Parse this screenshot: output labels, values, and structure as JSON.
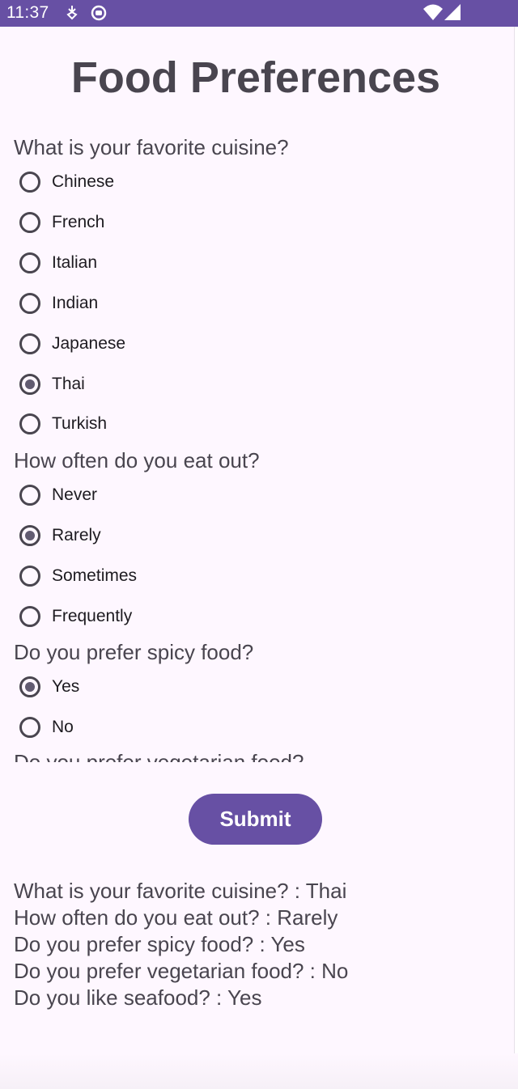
{
  "status_bar": {
    "time": "11:37",
    "icons": [
      "download-icon",
      "app-icon",
      "wifi-icon",
      "signal-icon"
    ],
    "color": "#6750a4"
  },
  "title": "Food Preferences",
  "questions": [
    {
      "label": "What is your favorite cuisine?",
      "options": [
        "Chinese",
        "French",
        "Italian",
        "Indian",
        "Japanese",
        "Thai",
        "Turkish"
      ],
      "selected": "Thai"
    },
    {
      "label": "How often do you eat out?",
      "options": [
        "Never",
        "Rarely",
        "Sometimes",
        "Frequently"
      ],
      "selected": "Rarely"
    },
    {
      "label": "Do you prefer spicy food?",
      "options": [
        "Yes",
        "No"
      ],
      "selected": "Yes"
    },
    {
      "label": "Do you prefer vegetarian food?",
      "options": [],
      "selected": ""
    }
  ],
  "submit_label": "Submit",
  "results": [
    "What is your favorite cuisine? : Thai",
    "How often do you eat out? : Rarely",
    "Do you prefer spicy food? : Yes",
    "Do you prefer vegetarian food? : No",
    "Do you like seafood? : Yes"
  ],
  "colors": {
    "accent": "#6750a4",
    "background": "#fef7ff",
    "text": "#49454f"
  }
}
